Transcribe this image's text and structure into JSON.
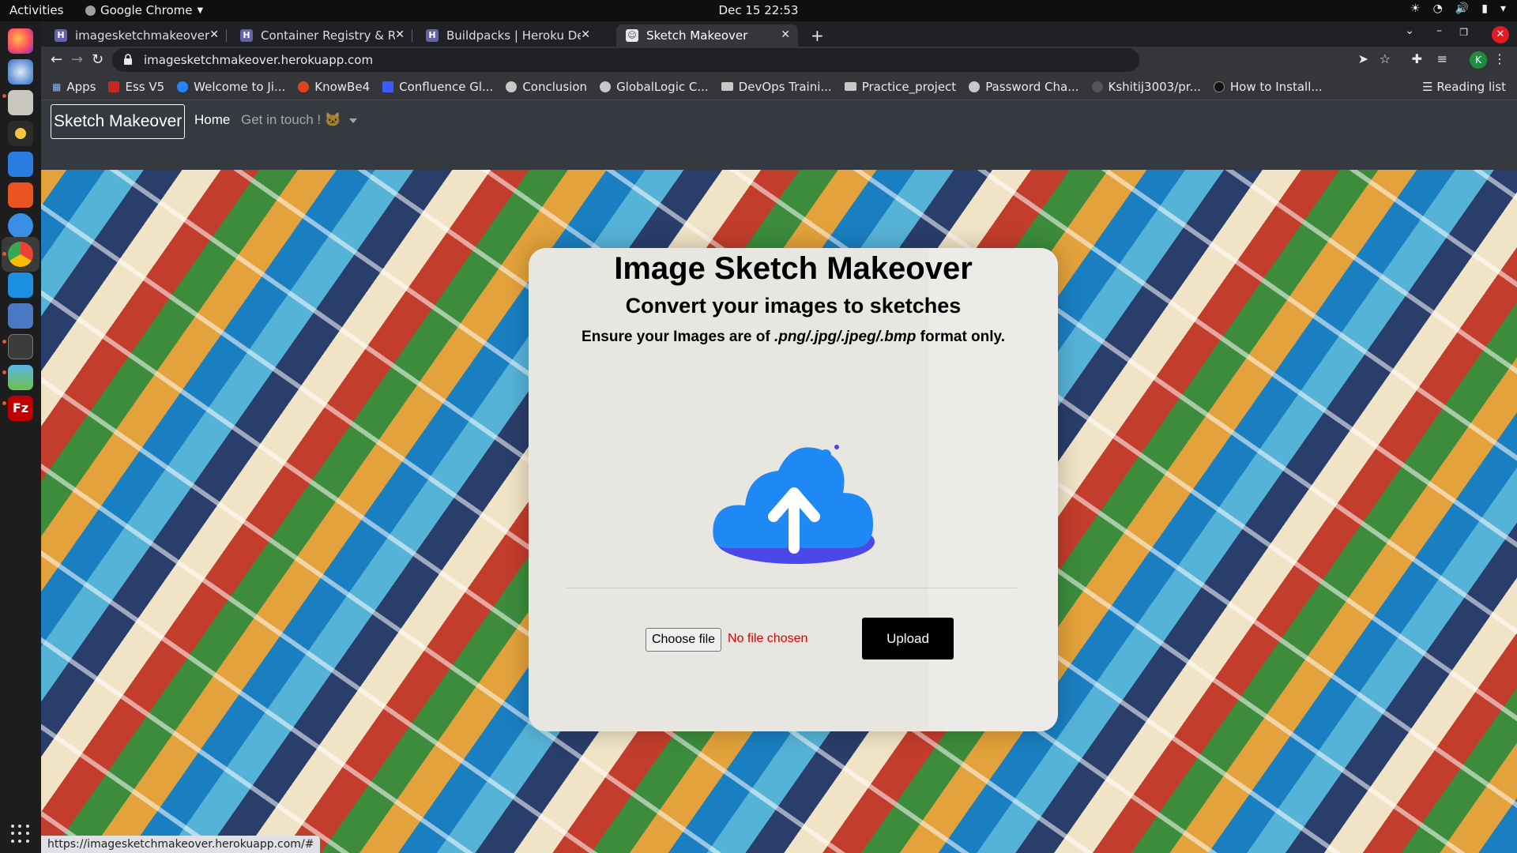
{
  "system": {
    "activities": "Activities",
    "app_menu": "Google Chrome",
    "clock": "Dec 15  22:53"
  },
  "tabs": [
    {
      "title": "imagesketchmakeover · G",
      "favicon": "heroku-icon"
    },
    {
      "title": "Container Registry & Runt",
      "favicon": "heroku-icon"
    },
    {
      "title": "Buildpacks | Heroku Dev C",
      "favicon": "heroku-icon"
    },
    {
      "title": "Sketch Makeover",
      "favicon": "sketch-icon",
      "active": true
    }
  ],
  "omnibox": {
    "url": "imagesketchmakeover.herokuapp.com"
  },
  "profile_initial": "K",
  "bookmarks": [
    {
      "label": "Apps",
      "icon": "apps-grid-icon"
    },
    {
      "label": "Ess V5",
      "icon": "ess-icon"
    },
    {
      "label": "Welcome to Ji...",
      "icon": "jira-icon"
    },
    {
      "label": "KnowBe4",
      "icon": "knowbe4-icon"
    },
    {
      "label": "Confluence Gl...",
      "icon": "confluence-icon"
    },
    {
      "label": "Conclusion",
      "icon": "globe-icon"
    },
    {
      "label": "GlobalLogic C...",
      "icon": "globe-icon"
    },
    {
      "label": "DevOps Traini...",
      "icon": "folder-icon"
    },
    {
      "label": "Practice_project",
      "icon": "folder-icon"
    },
    {
      "label": "Password Cha...",
      "icon": "globe-icon"
    },
    {
      "label": "Kshitij3003/pr...",
      "icon": "github-icon"
    },
    {
      "label": "How to Install...",
      "icon": "site-icon"
    }
  ],
  "reading_list": "Reading list",
  "site": {
    "brand": "Sketch Makeover",
    "nav_home": "Home",
    "nav_touch": "Get in touch ! 🐱",
    "title": "Image Sketch Makeover",
    "subtitle": "Convert your images to sketches",
    "note_prefix": "Ensure your Images are of ",
    "note_formats": ".png/.jpg/.jpeg/.bmp",
    "note_suffix": " format only.",
    "choose_file": "Choose file",
    "no_file": "No file chosen",
    "upload": "Upload"
  },
  "status_url": "https://imagesketchmakeover.herokuapp.com/#",
  "colors": {
    "navbar": "#343a40",
    "cloud_blue": "#1e88f5",
    "cloud_dark": "#4b47e8",
    "no_file_red": "#dd0000"
  }
}
